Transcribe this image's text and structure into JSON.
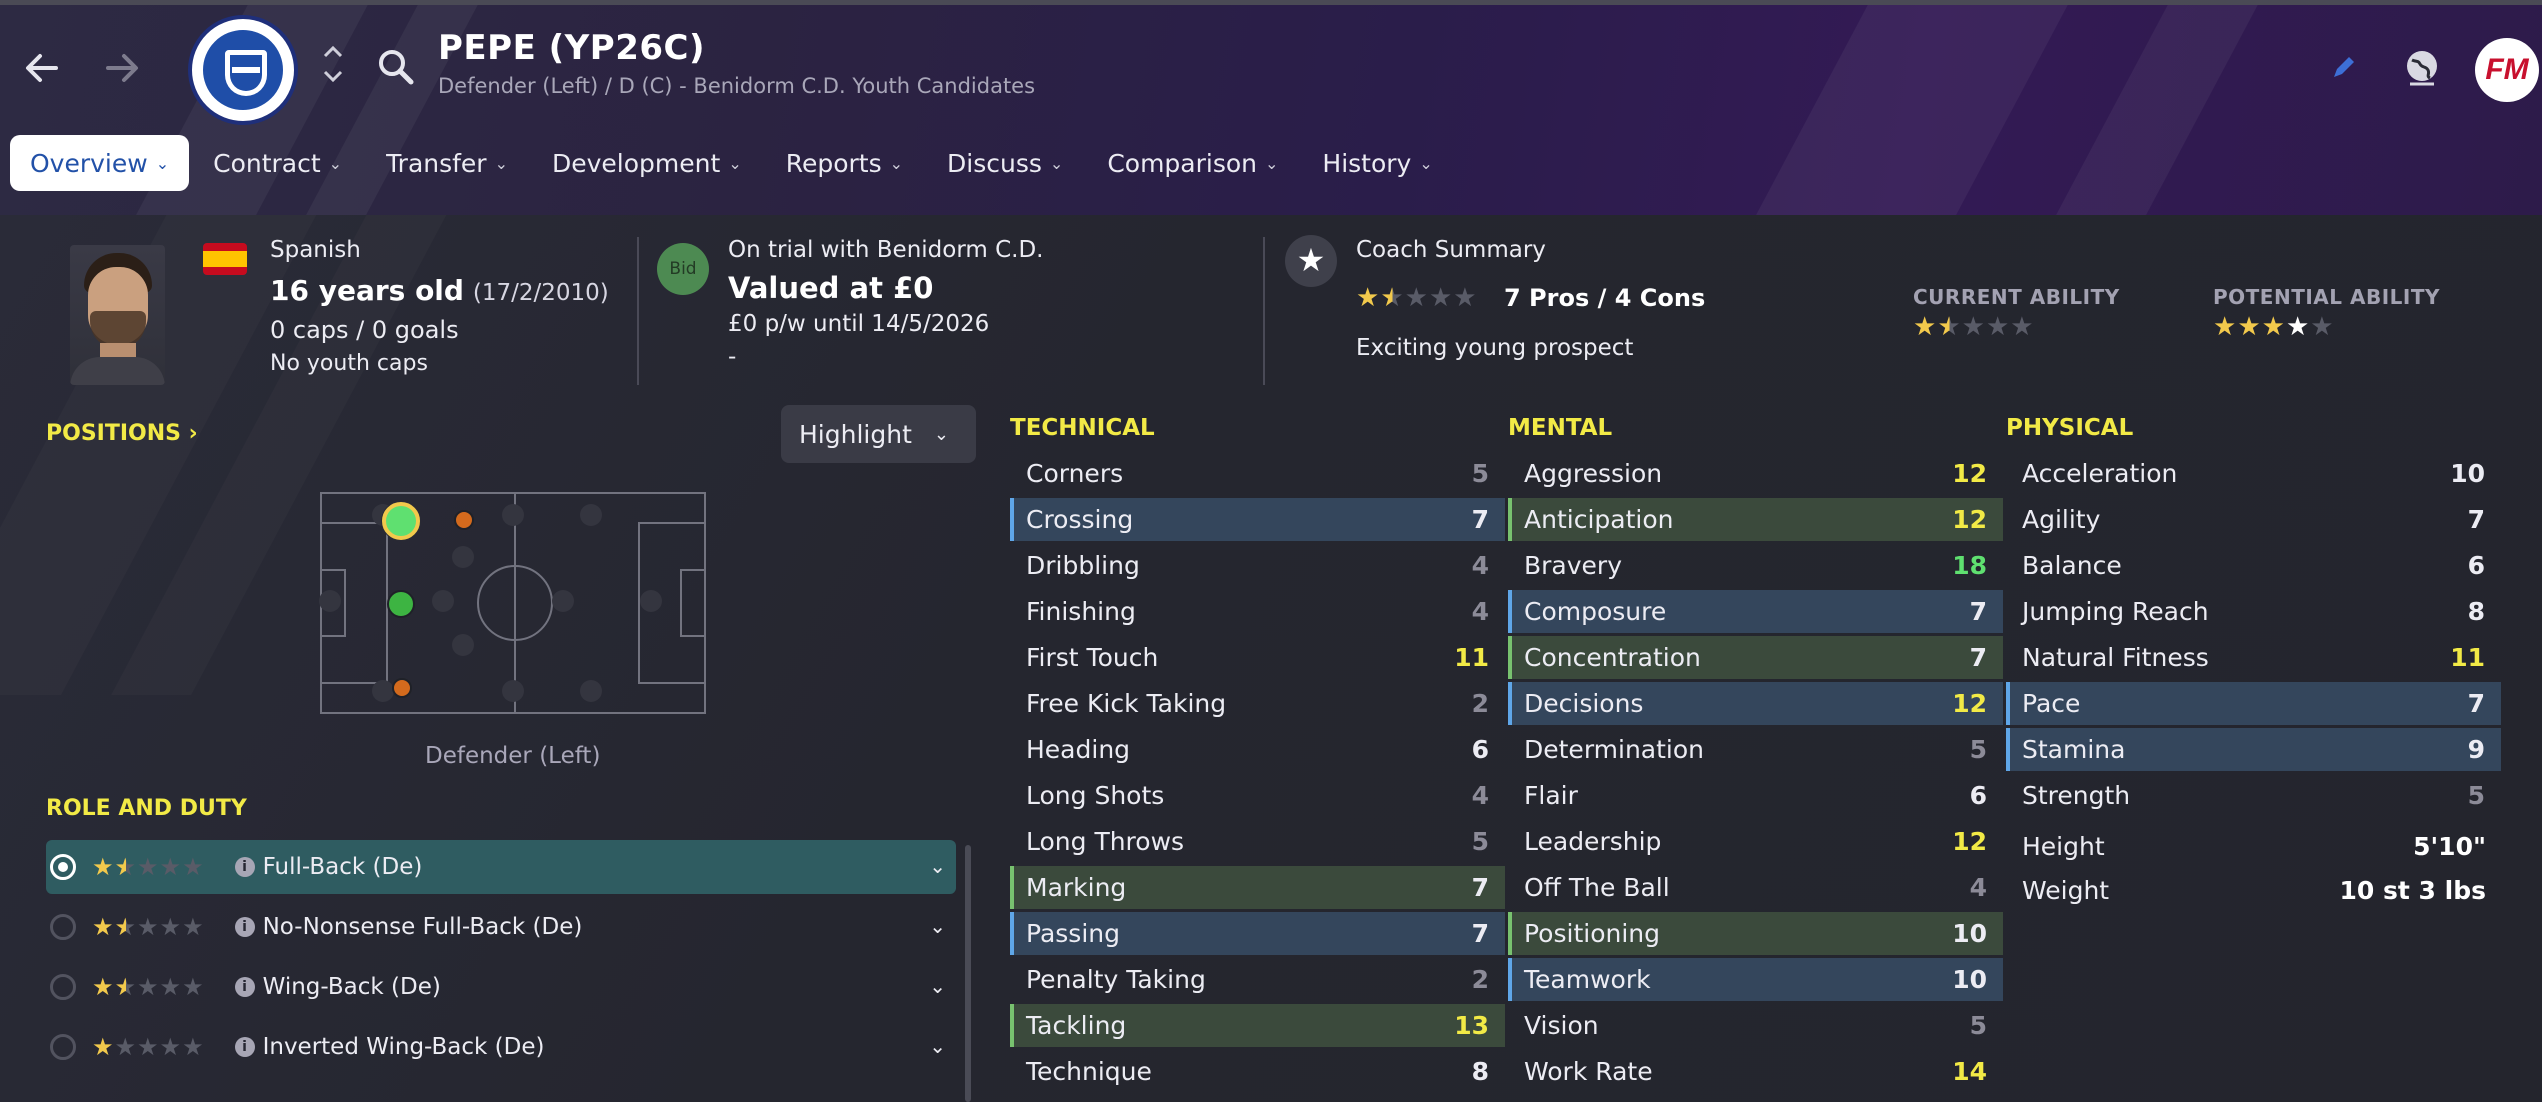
{
  "header": {
    "player_name": "PEPE (YP26C)",
    "player_subtitle": "Defender (Left) / D (C) - Benidorm C.D. Youth Candidates",
    "fm_logo": "FM"
  },
  "tabs": [
    {
      "label": "Overview",
      "active": true
    },
    {
      "label": "Contract"
    },
    {
      "label": "Transfer"
    },
    {
      "label": "Development"
    },
    {
      "label": "Reports"
    },
    {
      "label": "Discuss"
    },
    {
      "label": "Comparison"
    },
    {
      "label": "History"
    }
  ],
  "info": {
    "nationality": "Spanish",
    "age": "16 years old",
    "dob": "(17/2/2010)",
    "caps_goals": "0 caps / 0 goals",
    "youth_caps": "No youth caps",
    "bid_label": "Bid",
    "trial": "On trial with Benidorm C.D.",
    "valued": "Valued at £0",
    "wage": "£0 p/w until 14/5/2026",
    "wage_extra": "-",
    "coach_summary_title": "Coach Summary",
    "coach_rating": 1.5,
    "pros_cons": "7 Pros / 4 Cons",
    "prospect_text": "Exciting young prospect",
    "current_ability_label": "CURRENT ABILITY",
    "current_ability_stars": 1.5,
    "potential_ability_label": "POTENTIAL ABILITY",
    "potential_ability_stars": 4
  },
  "positions": {
    "title": "POSITIONS",
    "highlight_label": "Highlight",
    "position_name": "Defender (Left)"
  },
  "roles": {
    "title": "ROLE AND DUTY",
    "items": [
      {
        "name": "Full-Back (De)",
        "stars": 1.5,
        "selected": true
      },
      {
        "name": "No-Nonsense Full-Back (De)",
        "stars": 1.5
      },
      {
        "name": "Wing-Back (De)",
        "stars": 1.5
      },
      {
        "name": "Inverted Wing-Back (De)",
        "stars": 1
      }
    ]
  },
  "attributes": {
    "technical": {
      "title": "TECHNICAL",
      "items": [
        {
          "name": "Corners",
          "value": 5
        },
        {
          "name": "Crossing",
          "value": 7,
          "hl": "blue"
        },
        {
          "name": "Dribbling",
          "value": 4
        },
        {
          "name": "Finishing",
          "value": 4
        },
        {
          "name": "First Touch",
          "value": 11
        },
        {
          "name": "Free Kick Taking",
          "value": 2
        },
        {
          "name": "Heading",
          "value": 6
        },
        {
          "name": "Long Shots",
          "value": 4
        },
        {
          "name": "Long Throws",
          "value": 5
        },
        {
          "name": "Marking",
          "value": 7,
          "hl": "green"
        },
        {
          "name": "Passing",
          "value": 7,
          "hl": "blue"
        },
        {
          "name": "Penalty Taking",
          "value": 2
        },
        {
          "name": "Tackling",
          "value": 13,
          "hl": "green"
        },
        {
          "name": "Technique",
          "value": 8
        }
      ]
    },
    "mental": {
      "title": "MENTAL",
      "items": [
        {
          "name": "Aggression",
          "value": 12
        },
        {
          "name": "Anticipation",
          "value": 12,
          "hl": "green"
        },
        {
          "name": "Bravery",
          "value": 18
        },
        {
          "name": "Composure",
          "value": 7,
          "hl": "blue"
        },
        {
          "name": "Concentration",
          "value": 7,
          "hl": "green"
        },
        {
          "name": "Decisions",
          "value": 12,
          "hl": "blue"
        },
        {
          "name": "Determination",
          "value": 5
        },
        {
          "name": "Flair",
          "value": 6
        },
        {
          "name": "Leadership",
          "value": 12
        },
        {
          "name": "Off The Ball",
          "value": 4
        },
        {
          "name": "Positioning",
          "value": 10,
          "hl": "green"
        },
        {
          "name": "Teamwork",
          "value": 10,
          "hl": "blue"
        },
        {
          "name": "Vision",
          "value": 5
        },
        {
          "name": "Work Rate",
          "value": 14
        }
      ]
    },
    "physical": {
      "title": "PHYSICAL",
      "items": [
        {
          "name": "Acceleration",
          "value": 10
        },
        {
          "name": "Agility",
          "value": 7
        },
        {
          "name": "Balance",
          "value": 6
        },
        {
          "name": "Jumping Reach",
          "value": 8
        },
        {
          "name": "Natural Fitness",
          "value": 11
        },
        {
          "name": "Pace",
          "value": 7,
          "hl": "blue"
        },
        {
          "name": "Stamina",
          "value": 9,
          "hl": "blue"
        },
        {
          "name": "Strength",
          "value": 5
        }
      ],
      "height_label": "Height",
      "height_value": "5'10\"",
      "weight_label": "Weight",
      "weight_value": "10 st 3 lbs"
    }
  },
  "colors": {
    "accent_yellow": "#f2ea46",
    "tab_active_text": "#2251a8",
    "highlight_blue": "#34465c",
    "highlight_green": "#3b4a3c",
    "role_selected": "#2f5c61"
  }
}
